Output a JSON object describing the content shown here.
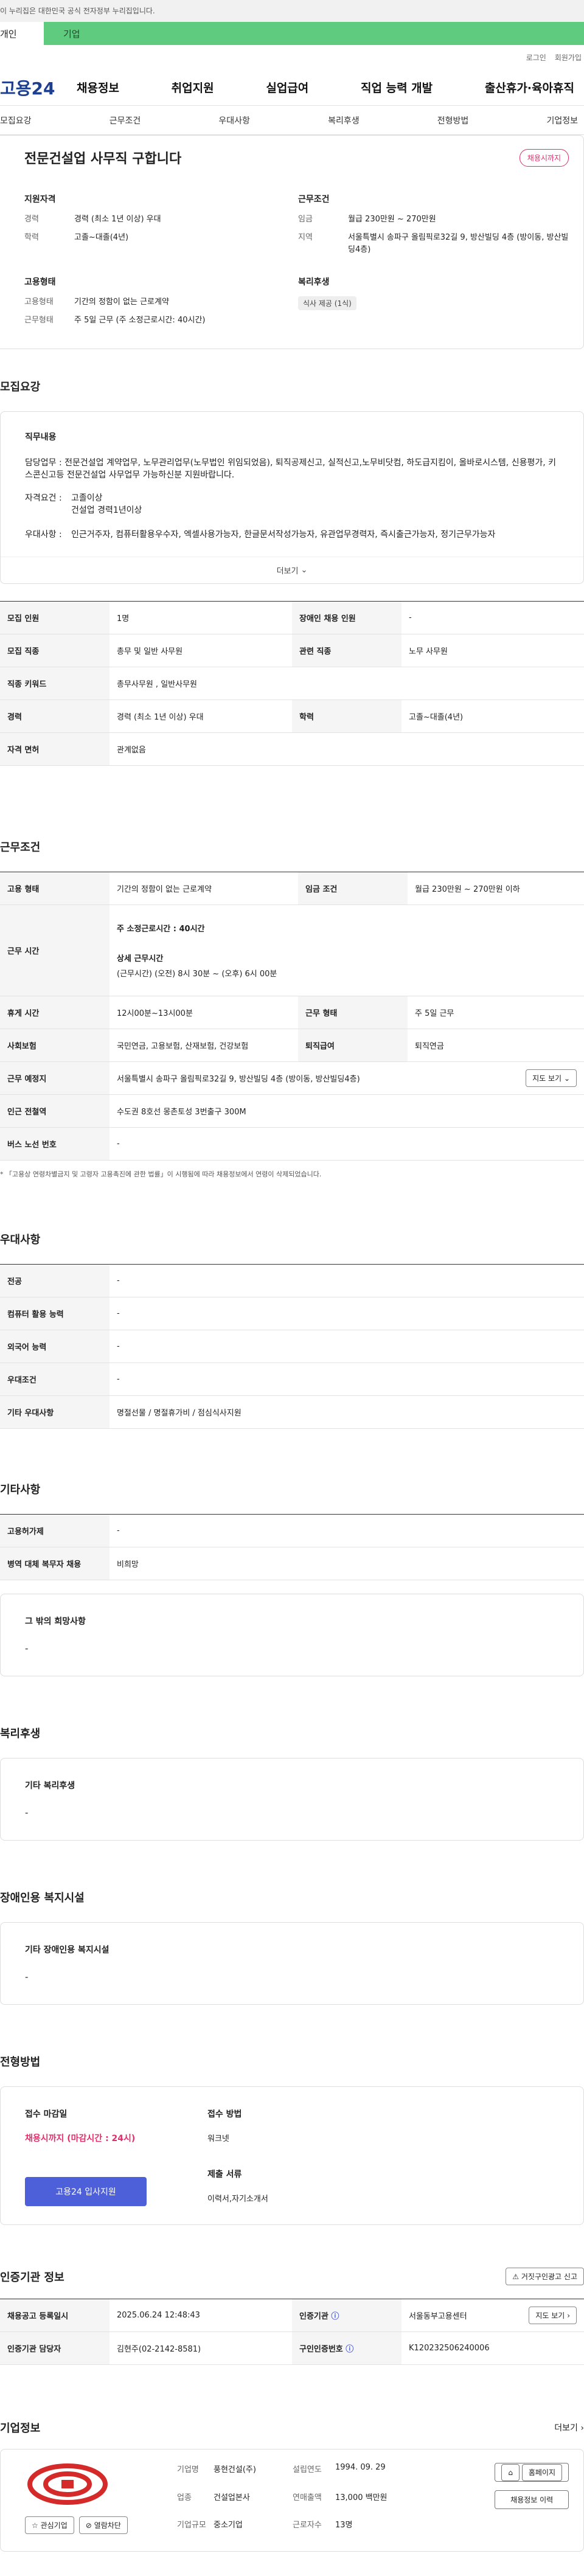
{
  "gov_banner": "이 누리집은 대한민국 공식 전자정부 누리집입니다.",
  "user_tabs": [
    "개인",
    "기업"
  ],
  "util": [
    "로그인",
    "회원가입"
  ],
  "logo": "고용24",
  "gnb": [
    "채용정보",
    "취업지원",
    "실업급여",
    "직업 능력 개발",
    "출산휴가·육아휴직"
  ],
  "subtabs": [
    "모집요강",
    "근무조건",
    "우대사항",
    "복리후생",
    "전형방법",
    "기업정보"
  ],
  "summary": {
    "title": "전문건설업 사무직 구합니다",
    "badge": "채용시까지",
    "qual_title": "지원자격",
    "career_k": "경력",
    "career_v": "경력 (최소 1년 이상) 우대",
    "edu_k": "학력",
    "edu_v": "고졸~대졸(4년)",
    "emp_title": "고용형태",
    "emptype_k": "고용형태",
    "emptype_v": "기간의 정함이 없는 근로계약",
    "worktype_k": "근무형태",
    "worktype_v": "주 5일 근무 (주 소정근로시간: 40시간)",
    "cond_title": "근무조건",
    "wage_k": "임금",
    "wage_v": "월급 230만원 ~ 270만원",
    "region_k": "지역",
    "region_v": "서울특별시 송파구 올림픽로32길 9, 방산빌딩 4층 (방이동, 방산빌딩4층)",
    "welfare_title": "복리후생",
    "welfare_tag": "식사 제공 (1식)"
  },
  "recruit": {
    "section": "모집요강",
    "duty_title": "직무내용",
    "duty_text": "담당업무 : 전문건설업 계약업무, 노무관리업무(노무법인 위임되었음), 퇴직공제신고, 실적신고,노무비닷컴, 하도급지킴이, 올바로시스템, 신용평가, 키스콘신고등  전문건설업 사무업무 가능하신분 지원바랍니다.",
    "req_k": "자격요건 :",
    "req_v1": "고졸이상",
    "req_v2": "건설업 경력1년이상",
    "pref_k": "우대사항 :",
    "pref_v": "인근거주자, 컴퓨터활용우수자, 엑셀사용가능자, 한글문서작성가능자, 유관업무경력자, 즉시출근가능자, 정기근무가능자",
    "more": "더보기",
    "rows": [
      [
        "모집 인원",
        "1명",
        "장애인 채용 인원",
        "-"
      ],
      [
        "모집 직종",
        "총무 및 일반 사무원",
        "관련 직종",
        "노무 사무원"
      ],
      [
        "직종 키워드",
        "총무사무원 , 일반사무원"
      ],
      [
        "경력",
        "경력 (최소 1년 이상) 우대",
        "학력",
        "고졸~대졸(4년)"
      ],
      [
        "자격 면허",
        "관계없음"
      ]
    ]
  },
  "work": {
    "section": "근무조건",
    "emptype_k": "고용 형태",
    "emptype_v": "기간의 정함이 없는 근로계약",
    "wage_k": "임금 조건",
    "wage_v": "월급 230만원 ~ 270만원 이하",
    "hours_k": "근무 시간",
    "hours_main": "주 소정근로시간 : 40시간",
    "hours_detail_title": "상세 근무시간",
    "hours_detail": "(근무시간) (오전) 8시 30분 ~ (오후) 6시 00분",
    "break_k": "휴게 시간",
    "break_v": "12시00분~13시00분",
    "form_k": "근무 형태",
    "form_v": "주 5일 근무",
    "ins_k": "사회보험",
    "ins_v": "국민연금, 고용보험, 산재보험, 건강보험",
    "sev_k": "퇴직급여",
    "sev_v": "퇴직연금",
    "addr_k": "근무 예정지",
    "addr_v": "서울특별시 송파구 올림픽로32길 9, 방산빌딩 4층 (방이동, 방산빌딩4층)",
    "map_btn": "지도 보기",
    "subway_k": "인근 전철역",
    "subway_v": "수도권 8호선 몽촌토성 3번출구 300M",
    "bus_k": "버스 노선 번호",
    "bus_v": "-",
    "note": "* 「고용상 연령차별금지 및 고령자 고용촉진에 관한 법률」이 시행됨에 따라 채용정보에서 연령이 삭제되었습니다."
  },
  "pref": {
    "section": "우대사항",
    "rows": [
      [
        "전공",
        "-"
      ],
      [
        "컴퓨터 활용 능력",
        "-"
      ],
      [
        "외국어 능력",
        "-"
      ],
      [
        "우대조건",
        "-"
      ],
      [
        "기타 우대사항",
        "명절선물 / 명절휴가비 / 점심식사지원"
      ]
    ]
  },
  "etc": {
    "section": "기타사항",
    "rows": [
      [
        "고용허가제",
        "-"
      ],
      [
        "병역 대체 복무자 채용",
        "비희망"
      ]
    ],
    "other_title": "그 밖의 희망사항",
    "other_v": "-"
  },
  "welfare": {
    "section": "복리후생",
    "title": "기타 복리후생",
    "v": "-"
  },
  "disabled": {
    "section": "장애인용 복지시설",
    "title": "기타 장애인용 복지시설",
    "v": "-"
  },
  "process": {
    "section": "전형방법",
    "deadline_k": "접수 마감일",
    "deadline_v": "채용시까지 (마감시간 : 24시)",
    "apply_btn": "고용24 입사지원",
    "method_k": "접수 방법",
    "method_v": "워크넷",
    "docs_k": "제출 서류",
    "docs_v": "이력서,자기소개서"
  },
  "agency": {
    "section": "인증기관 정보",
    "report_btn": "거짓구인광고 신고",
    "reg_k": "채용공고 등록일시",
    "reg_v": "2025.06.24 12:48:43",
    "org_k": "인증기관",
    "org_v": "서울동부고용센터",
    "map_btn": "지도 보기",
    "mgr_k": "인증기관 담당자",
    "mgr_v": "김현주(02-2142-8581)",
    "cert_k": "구인인증번호",
    "cert_v": "K120232506240006"
  },
  "company": {
    "section": "기업정보",
    "more": "더보기",
    "fav_btn": "관심기업",
    "block_btn": "열람차단",
    "name_k": "기업명",
    "name_v": "풍현건설(주)",
    "ind_k": "업종",
    "ind_v": "건설업본사",
    "scale_k": "기업규모",
    "scale_v": "중소기업",
    "est_k": "설립연도",
    "est_v": "1994. 09. 29",
    "rev_k": "연매출액",
    "rev_v": "13,000 백만원",
    "emp_k": "근로자수",
    "emp_v": "13명",
    "home_btn": "홈페이지",
    "hist_btn": "채용정보 이력"
  },
  "colors": {
    "accent_green": "#5fcb7f",
    "brand_blue": "#1e3f8f",
    "apply_blue": "#4d5fd9",
    "badge_pink": "#e0306a"
  }
}
